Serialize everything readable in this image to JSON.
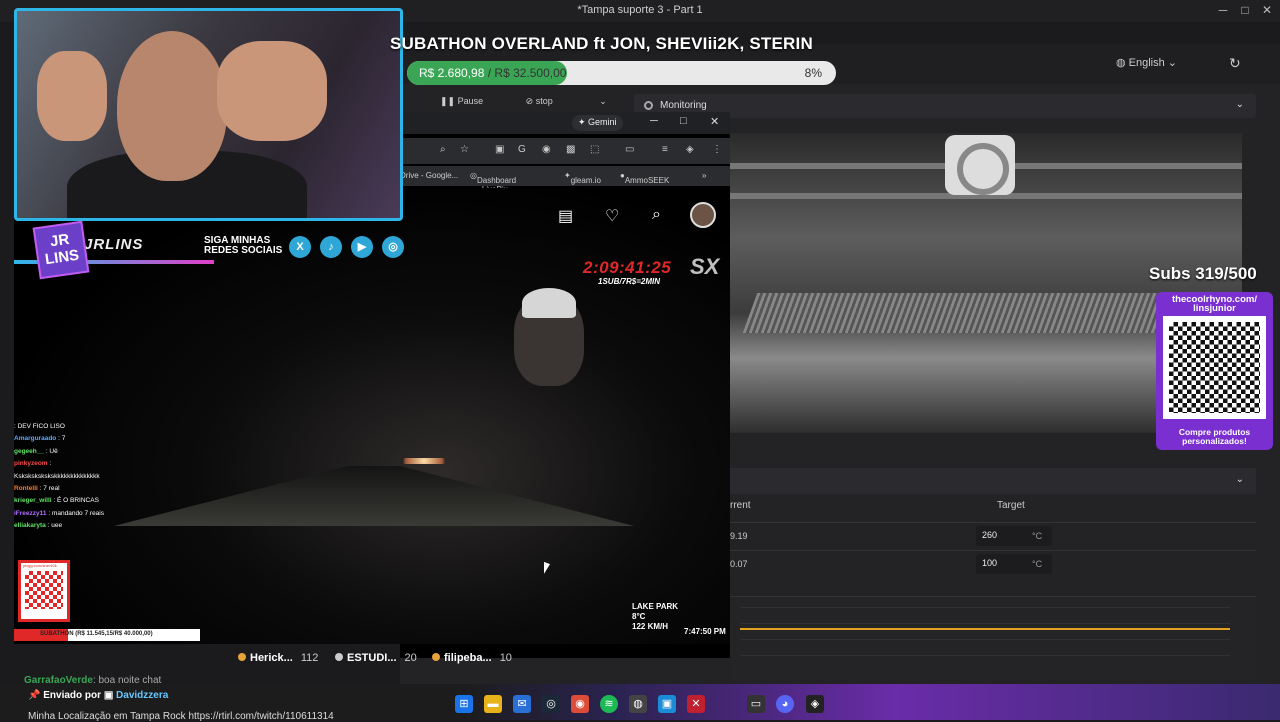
{
  "window": {
    "title": "*Tampa suporte 3 - Part 1",
    "minimize": "─",
    "maximize": "□",
    "close": "✕"
  },
  "app": {
    "language": "English",
    "controls": {
      "pause": "Pause",
      "stop": "stop"
    },
    "monitoring_label": "Monitoring",
    "table": {
      "col_current": "rrent",
      "col_target": "Target",
      "rows": [
        {
          "current": "9.19",
          "target": "260",
          "unit": "°C"
        },
        {
          "current": "0.07",
          "target": "100",
          "unit": "°C"
        }
      ]
    },
    "accent": "#e2a31e"
  },
  "overlay": {
    "subathon_title": "SUBATHON OVERLAND ft JON, SHEVIii2K, STERIN",
    "goal_current": "R$ 2.680,98",
    "goal_separator": " / ",
    "goal_target": "R$ 32.500,00",
    "goal_percent_label": "8%",
    "goal_fraction": 0.08,
    "subs_counter": "Subs 319/500",
    "qr_url": "thecoolrhyno.com/ linsjunior",
    "qr_cta": "Compre produtos personalizados!",
    "social": {
      "logo_text": "JR LINS",
      "name": "JRLINS",
      "follow_text": "SIGA MINHAS REDES SOCIAIS",
      "icons": [
        {
          "name": "x-icon",
          "glyph": "X"
        },
        {
          "name": "tiktok-icon",
          "glyph": "♪"
        },
        {
          "name": "youtube-icon",
          "glyph": "▶"
        },
        {
          "name": "instagram-icon",
          "glyph": "◎"
        }
      ]
    }
  },
  "browser": {
    "gemini_label": "✦ Gemini",
    "bookmarks": [
      "Drive - Google...",
      "Dashboard - LivePix",
      "gleam.io",
      "AmmoSEEK"
    ],
    "bookmarks_more": "»"
  },
  "stream": {
    "timer": "2:09:41:25",
    "timer_rule": "1SUB/7R$=2MIN",
    "sx_logo": "SX",
    "dash_location": "LAKE PARK",
    "dash_temp": "8°C",
    "dash_speed": "122 KM/H",
    "dash_time": "7:47:50 PM",
    "small_goal_text": "SUBATHON (R$ 11.545,15/R$ 40.000,00)",
    "small_goal_fraction": 0.29,
    "small_qr_label": "pixgg.com/shevii2k",
    "chat": [
      {
        "user": "",
        "text": ": DEV FICO LISO",
        "color": "#8a8aff"
      },
      {
        "user": "Amarguraado",
        "text": ": 7",
        "color": "#5fa8ff"
      },
      {
        "user": "gegeeh__",
        "text": ": Uê",
        "color": "#64e36b"
      },
      {
        "user": "pinkyzeom",
        "text": ":",
        "color": "#ff4a4a"
      },
      {
        "user": "",
        "text": "Kskskskskskskkkkkkkkkkkkkk",
        "color": "#fff"
      },
      {
        "user": "Rontelli",
        "text": ": 7 real",
        "color": "#ff7b2e"
      },
      {
        "user": "krieger_willi",
        "text": ": É O BRINCAS",
        "color": "#64e36b"
      },
      {
        "user": "iFreezzy11",
        "text": ": mandando 7 reais",
        "color": "#b370ff"
      },
      {
        "user": "elliakaryta",
        "text": ": uee",
        "color": "#64e36b"
      }
    ],
    "leaderboard": [
      {
        "name": "Herick...",
        "count": "112"
      },
      {
        "name": "ESTUDI...",
        "count": "20"
      },
      {
        "name": "filipeba...",
        "count": "10"
      }
    ]
  },
  "bottom": {
    "chat_user": "GarrafaoVerde",
    "chat_text": ": boa noite chat",
    "enviado_prefix": "Enviado por",
    "enviado_user": "Davidzzera",
    "message": "Minha Localização em Tampa Rock https://rtirl.com/twitch/110611314"
  }
}
